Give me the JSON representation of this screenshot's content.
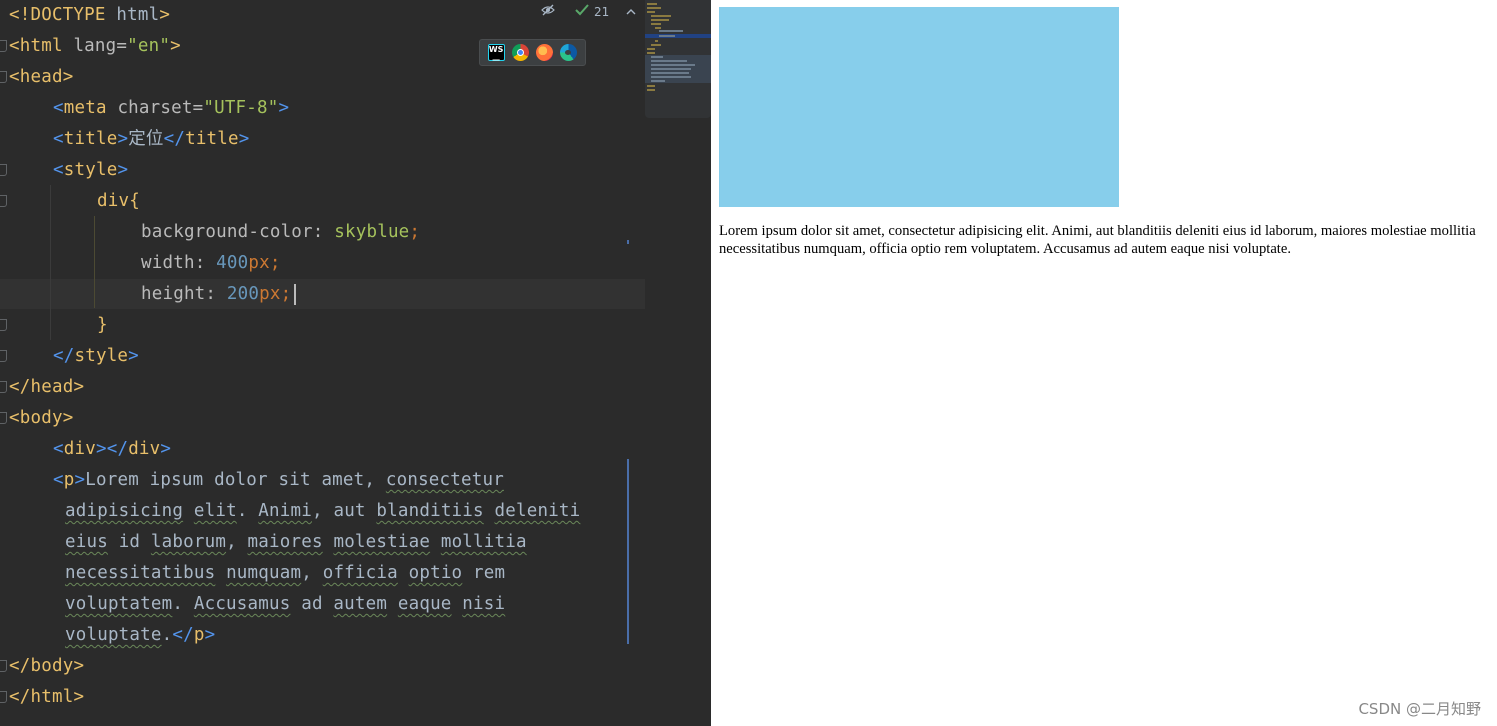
{
  "editor": {
    "lines": {
      "l1_doctype": "<!DOCTYPE",
      "l1_html": " html",
      "l1_close": ">",
      "l2_open": "<",
      "l2_tag": "html",
      "l2_attr": " lang",
      "l2_eq": "=",
      "l2_val": "\"en\"",
      "l2_close": ">",
      "l3_open": "<",
      "l3_tag": "head",
      "l3_close": ">",
      "l4_open": "<",
      "l4_tag": "meta",
      "l4_attr": " charset",
      "l4_eq": "=",
      "l4_val": "\"UTF-8\"",
      "l4_close": ">",
      "l5_open": "<",
      "l5_tag": "title",
      "l5_mid": ">",
      "l5_text": "定位",
      "l5_close_open": "</",
      "l5_close_tag": "title",
      "l5_close": ">",
      "l6_open": "<",
      "l6_tag": "style",
      "l6_close": ">",
      "l7_sel": "div{",
      "l8_prop": "background-color",
      "l8_colon": ": ",
      "l8_val": "skyblue",
      "l8_semi": ";",
      "l9_prop": "width",
      "l9_colon": ": ",
      "l9_num": "400",
      "l9_unit": "px",
      "l9_semi": ";",
      "l10_prop": "height",
      "l10_colon": ": ",
      "l10_num": "200",
      "l10_unit": "px",
      "l10_semi": ";",
      "l11_brace": "}",
      "l12_open": "</",
      "l12_tag": "style",
      "l12_close": ">",
      "l13_open": "</",
      "l13_tag": "head",
      "l13_close": ">",
      "l14_open": "<",
      "l14_tag": "body",
      "l14_close": ">",
      "l15_open": "<",
      "l15_tag": "div",
      "l15_mid": "></",
      "l15_tag2": "div",
      "l15_close": ">",
      "l16_open": "<",
      "l16_tag": "p",
      "l16_mid": ">",
      "l16_text_a": "Lorem ipsum dolor sit amet, ",
      "l16_text_b": "consectetur",
      "l17_w1": "adipisicing",
      "l17_sp1": " ",
      "l17_w2": "elit",
      "l17_sp2": ". ",
      "l17_w3": "Animi",
      "l17_sp3": ", aut ",
      "l17_w4": "blanditiis",
      "l17_sp4": " ",
      "l17_w5": "deleniti",
      "l18_w1": "eius",
      "l18_sp1": " id ",
      "l18_w2": "laborum",
      "l18_sp2": ", ",
      "l18_w3": "maiores",
      "l18_sp3": " ",
      "l18_w4": "molestiae",
      "l18_sp4": " ",
      "l18_w5": "mollitia",
      "l19_w1": "necessitatibus",
      "l19_sp1": " ",
      "l19_w2": "numquam",
      "l19_sp2": ", ",
      "l19_w3": "officia",
      "l19_sp3": " ",
      "l19_w4": "optio",
      "l19_sp4": " rem",
      "l20_w1": "voluptatem",
      "l20_sp1": ". ",
      "l20_w2": "Accusamus",
      "l20_sp2": " ad ",
      "l20_w3": "autem",
      "l20_sp3": " ",
      "l20_w4": "eaque",
      "l20_sp4": " ",
      "l20_w5": "nisi",
      "l21_w1": "voluptate",
      "l21_text": ".",
      "l21_close_open": "</",
      "l21_close_tag": "p",
      "l21_close": ">",
      "l22_open": "</",
      "l22_tag": "body",
      "l22_close": ">",
      "l23_open": "</",
      "l23_tag": "html",
      "l23_close": ">"
    },
    "inspection_count": "21"
  },
  "preview": {
    "paragraph": "Lorem ipsum dolor sit amet, consectetur adipisicing elit. Animi, aut blanditiis deleniti eius id laborum, maiores molestiae mollitia necessitatibus numquam, officia optio rem voluptatem. Accusamus ad autem eaque nisi voluptate.",
    "div_color": "#87ceeb"
  },
  "watermark": "CSDN @二月知野",
  "icons": [
    "eye-hidden-icon",
    "check-icon",
    "arrow-up-icon",
    "arrow-down-icon",
    "webstorm-icon",
    "chrome-icon",
    "firefox-icon",
    "edge-icon"
  ],
  "colors": {
    "editor_bg": "#2b2b2b",
    "tag": "#e8bf6a",
    "bracket": "#5394ec",
    "string": "#a5c25c",
    "number": "#6897bb"
  }
}
